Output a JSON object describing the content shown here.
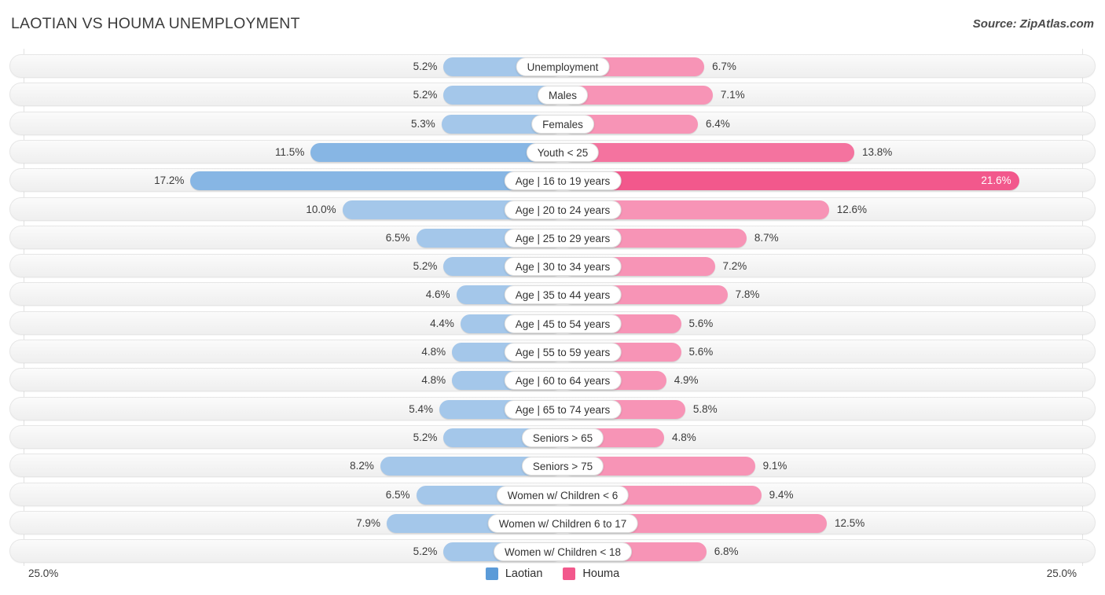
{
  "header": {
    "title": "LAOTIAN VS HOUMA UNEMPLOYMENT",
    "source": "Source: ZipAtlas.com"
  },
  "axis": {
    "left_label": "25.0%",
    "right_label": "25.0%"
  },
  "legend": [
    {
      "name": "Laotian",
      "color": "#5b9bd8"
    },
    {
      "name": "Houma",
      "color": "#f2588c"
    }
  ],
  "chart_data": {
    "type": "bar",
    "title": "LAOTIAN VS HOUMA UNEMPLOYMENT",
    "subtitle": "Source: ZipAtlas.com",
    "orientation": "horizontal-diverging",
    "xlabel": "",
    "ylabel": "",
    "xlim": [
      25.0,
      25.0
    ],
    "axis_left_max": 25.0,
    "axis_right_max": 25.0,
    "unit": "%",
    "grid": true,
    "legend_position": "bottom-center",
    "categories": [
      "Unemployment",
      "Males",
      "Females",
      "Youth < 25",
      "Age | 16 to 19 years",
      "Age | 20 to 24 years",
      "Age | 25 to 29 years",
      "Age | 30 to 34 years",
      "Age | 35 to 44 years",
      "Age | 45 to 54 years",
      "Age | 55 to 59 years",
      "Age | 60 to 64 years",
      "Age | 65 to 74 years",
      "Seniors > 65",
      "Seniors > 75",
      "Women w/ Children < 6",
      "Women w/ Children 6 to 17",
      "Women w/ Children < 18"
    ],
    "series": [
      {
        "name": "Laotian",
        "color": "#5b9bd8",
        "values": [
          5.2,
          5.2,
          5.3,
          11.5,
          17.2,
          10.0,
          6.5,
          5.2,
          4.6,
          4.4,
          4.8,
          4.8,
          5.4,
          5.2,
          8.2,
          6.5,
          7.9,
          5.2
        ],
        "labels": [
          "5.2%",
          "5.2%",
          "5.3%",
          "11.5%",
          "17.2%",
          "10.0%",
          "6.5%",
          "5.2%",
          "4.6%",
          "4.4%",
          "4.8%",
          "4.8%",
          "5.4%",
          "5.2%",
          "8.2%",
          "6.5%",
          "7.9%",
          "5.2%"
        ]
      },
      {
        "name": "Houma",
        "color": "#f2588c",
        "values": [
          6.7,
          7.1,
          6.4,
          13.8,
          21.6,
          12.6,
          8.7,
          7.2,
          7.8,
          5.6,
          5.6,
          4.9,
          5.8,
          4.8,
          9.1,
          9.4,
          12.5,
          6.8
        ],
        "labels": [
          "6.7%",
          "7.1%",
          "6.4%",
          "13.8%",
          "21.6%",
          "12.6%",
          "8.7%",
          "7.2%",
          "7.8%",
          "5.6%",
          "5.6%",
          "4.9%",
          "5.8%",
          "4.8%",
          "9.1%",
          "9.4%",
          "12.5%",
          "6.8%"
        ]
      }
    ]
  }
}
